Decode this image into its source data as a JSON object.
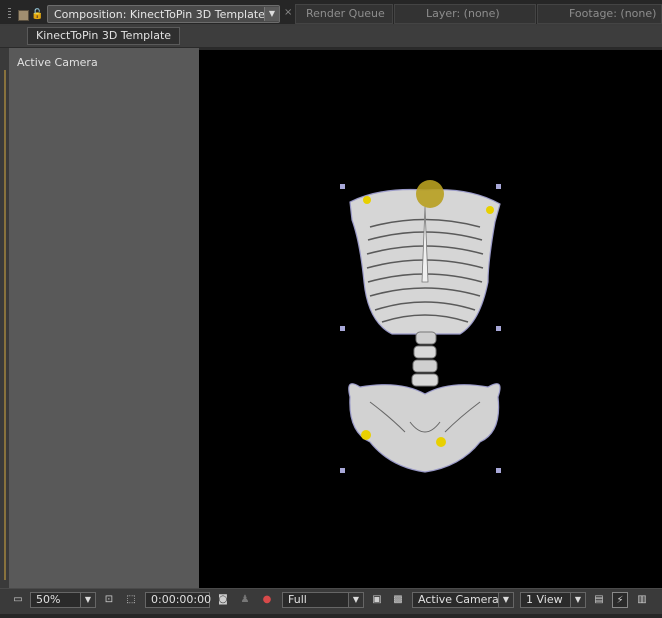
{
  "tab_bar": {
    "active_tab": "Composition: KinectToPin 3D Template",
    "tabs": [
      "Render Queue",
      "Layer: (none)",
      "Footage: (none)"
    ],
    "close_glyph": "×",
    "icons": [
      "panel-grip-icon",
      "comp-swatch-icon",
      "lock-icon",
      "dropdown-arrow-icon",
      "close-icon"
    ]
  },
  "breadcrumb": {
    "label": "KinectToPin 3D Template"
  },
  "viewer": {
    "camera_label": "Active Camera",
    "canvas_color": "#000000",
    "pasteboard_color": "#595959",
    "layer_content": "skeleton-torso-image"
  },
  "bottom_toolbar": {
    "zoom": "50%",
    "timecode": "0:00:00:00",
    "resolution": "Full",
    "camera": "Active Camera",
    "views": "1 View",
    "icons": [
      "always-preview-icon",
      "region-of-interest-icon",
      "transparency-grid-icon",
      "snapshot-icon",
      "show-snapshot-icon",
      "color-channels-icon",
      "fast-preview-icon",
      "3d-draft-icon"
    ]
  },
  "colors": {
    "panel_dark": "#262626",
    "panel_mid": "#3d3d3d",
    "accent_orange": "#c8a040",
    "handle_color": "#a8a8d8",
    "joint_yellow": "#e8d000"
  }
}
